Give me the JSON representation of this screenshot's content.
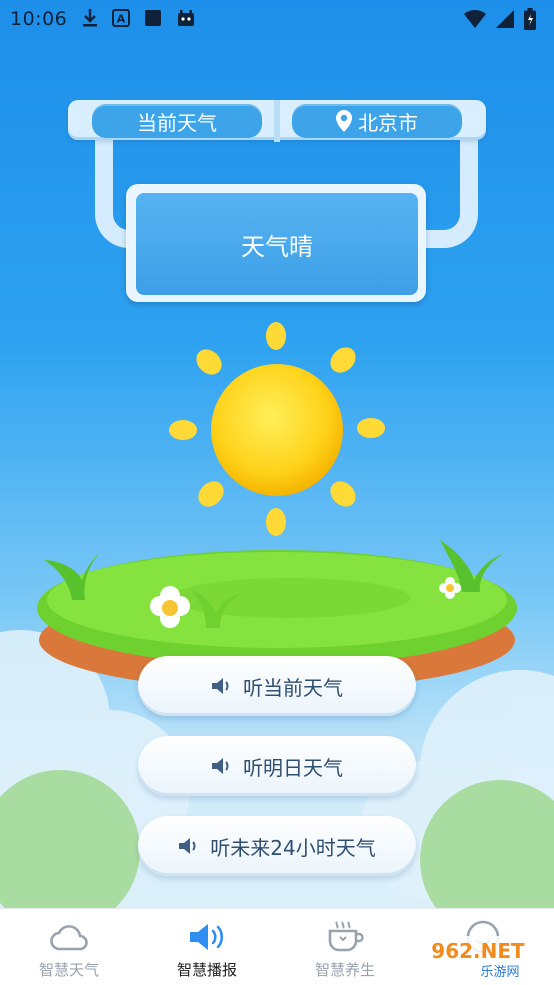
{
  "status_bar": {
    "time": "10:06"
  },
  "sign": {
    "left_label": "当前天气",
    "right_label": "北京市",
    "condition": "天气晴"
  },
  "buttons": [
    {
      "label": "听当前天气"
    },
    {
      "label": "听明日天气"
    },
    {
      "label": "听未来24小时天气"
    }
  ],
  "tabs": [
    {
      "label": "智慧天气",
      "icon": "cloud-icon",
      "active": false
    },
    {
      "label": "智慧播报",
      "icon": "speaker-icon",
      "active": true
    },
    {
      "label": "智慧养生",
      "icon": "teacup-icon",
      "active": false
    },
    {
      "label": "",
      "icon": "smile-icon",
      "active": false
    }
  ],
  "watermark": {
    "text": "962.NET",
    "sub": "乐游网"
  },
  "colors": {
    "accent": "#3ea4ea",
    "active_tab_icon": "#2f8ff0"
  }
}
